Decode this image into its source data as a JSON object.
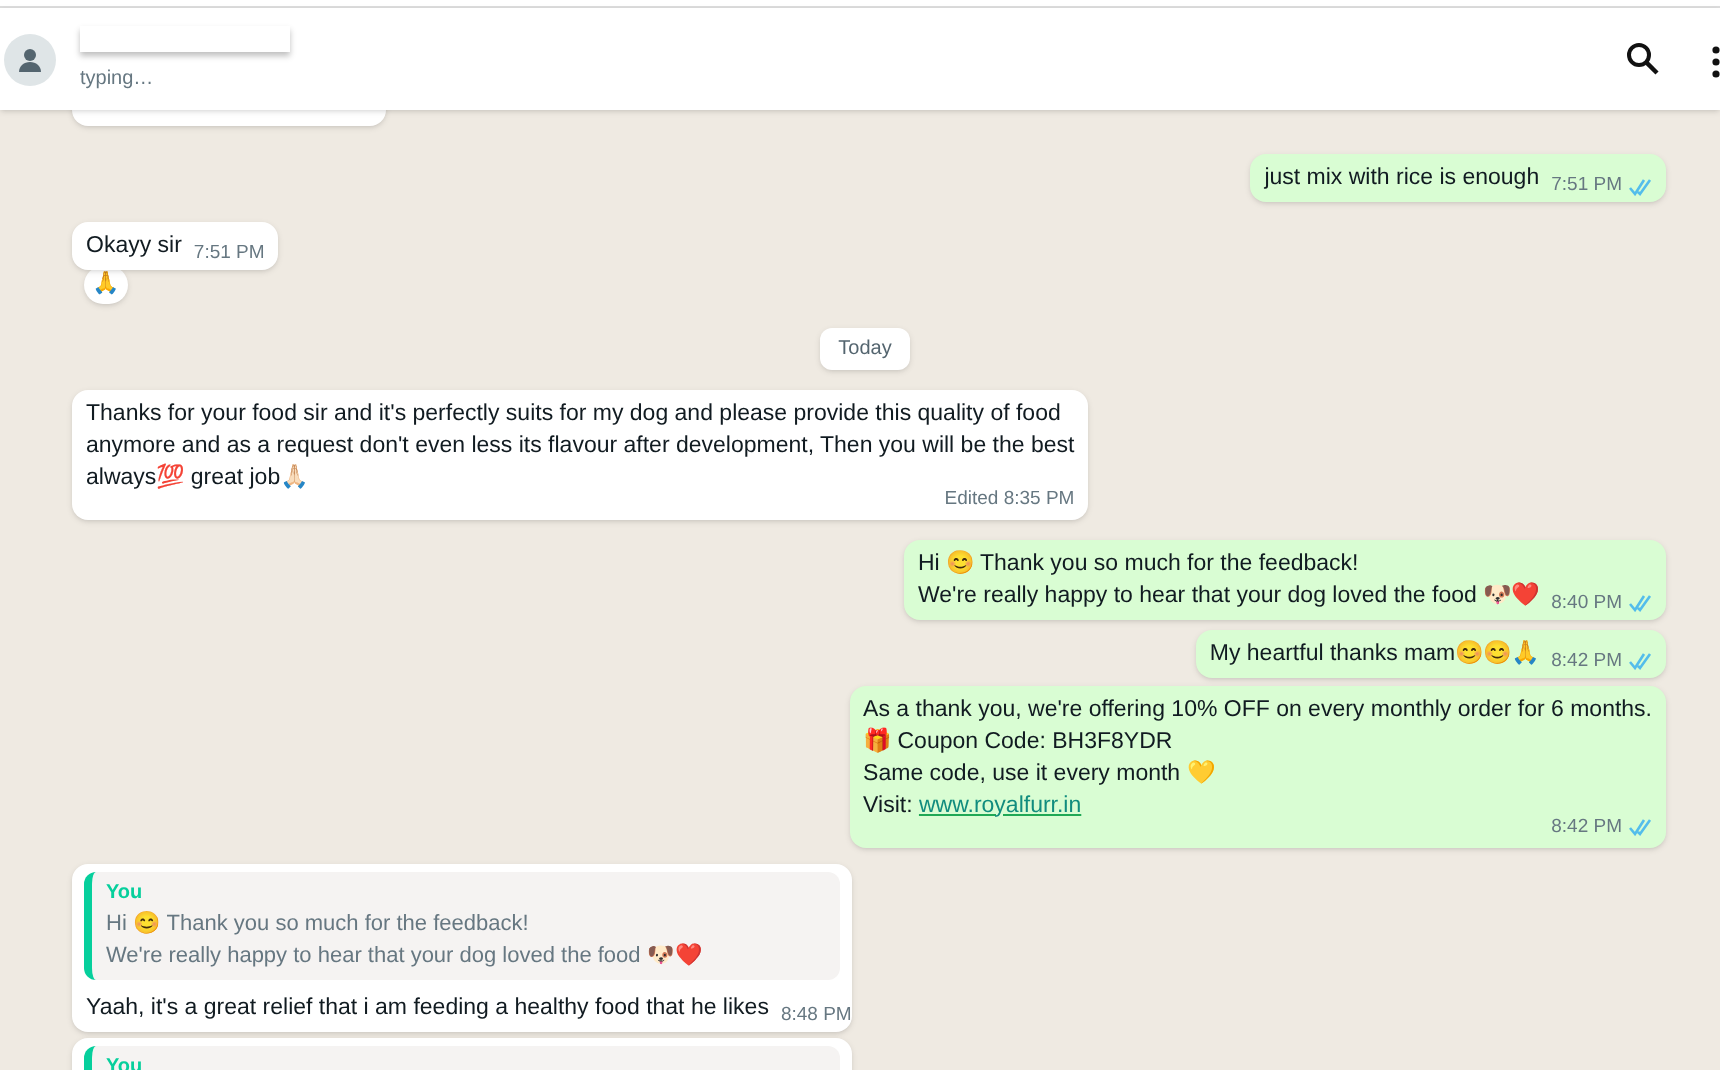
{
  "header": {
    "status": "typing…"
  },
  "messages": [
    {
      "kind": "partial"
    },
    {
      "kind": "outgoing",
      "lines": [
        "just mix with rice is enough"
      ],
      "time": "7:51 PM",
      "read": true
    },
    {
      "kind": "incoming",
      "lines": [
        "Okayy sir"
      ],
      "time": "7:51 PM",
      "reaction": "🙏"
    },
    {
      "kind": "date",
      "label": "Today"
    },
    {
      "kind": "incoming",
      "lines": [
        "Thanks for your food sir and it's perfectly suits for my dog and please provide this quality of food",
        "anymore and as a request don't even less its flavour after development,  Then you will be the best",
        "always💯 great job🙏🏻"
      ],
      "time": "Edited 8:35 PM"
    },
    {
      "kind": "outgoing",
      "lines": [
        "Hi 😊 Thank you so much for the feedback!",
        "We're really happy to hear that your dog loved the food 🐶❤️"
      ],
      "time": "8:40 PM",
      "read": true
    },
    {
      "kind": "outgoing",
      "lines": [
        "My heartful thanks mam😊😊🙏"
      ],
      "time": "8:42 PM",
      "read": true
    },
    {
      "kind": "outgoing",
      "lines": [
        "As a thank you, we're offering 10% OFF on every monthly order for 6 months.",
        "🎁 Coupon Code: BH3F8YDR",
        "Same code, use it every month 💛"
      ],
      "link_line": {
        "label": "Visit:",
        "url": "www.royalfurr.in"
      },
      "time": "8:42 PM",
      "read": true
    },
    {
      "kind": "reply",
      "quote": {
        "author": "You",
        "lines": [
          "Hi 😊 Thank you so much for the feedback!",
          "We're really happy to hear that your dog loved the food 🐶❤️"
        ]
      },
      "lines": [
        "Yaah, it's a great relief that i am feeding a healthy food that he likes"
      ],
      "time": "8:48 PM"
    },
    {
      "kind": "reply",
      "quote": {
        "author": "You"
      }
    }
  ]
}
